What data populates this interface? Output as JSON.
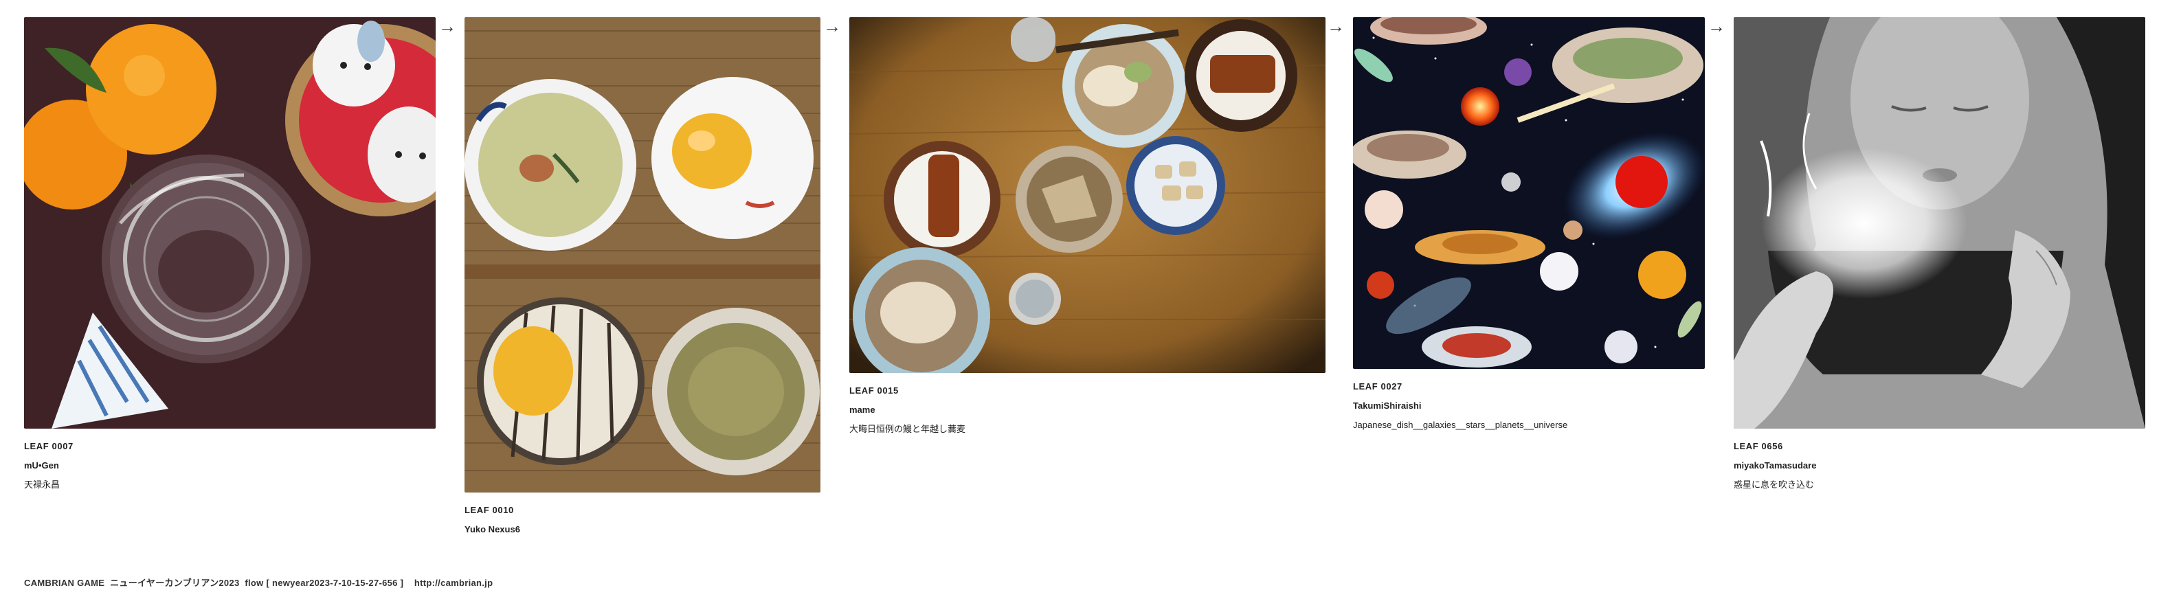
{
  "leaves": [
    {
      "id": "LEAF 0007",
      "author": "mU•Gen",
      "title": "天禄永昌",
      "image": "oranges-and-glass-cup"
    },
    {
      "id": "LEAF 0010",
      "author": "Yuko Nexus6",
      "title": "",
      "image": "tea-bowls-on-mat"
    },
    {
      "id": "LEAF 0015",
      "author": "mame",
      "title": "大晦日恒例の鰻と年越し蕎麦",
      "image": "unagi-and-soba-dishes"
    },
    {
      "id": "LEAF 0027",
      "author": "TakumiShiraishi",
      "title": "Japanese_dish__galaxies__stars__planets__universe",
      "image": "space-dishes-collage"
    },
    {
      "id": "LEAF 0656",
      "author": "miyakoTamasudare",
      "title": "惑星に息を吹き込む",
      "image": "woman-breathing-into-bowl"
    }
  ],
  "arrow_glyph": "→",
  "footer": {
    "text": "CAMBRIAN GAME  ニューイヤーカンブリアン2023  flow [ newyear2023-7-10-15-27-656 ]    http://cambrian.jp"
  }
}
